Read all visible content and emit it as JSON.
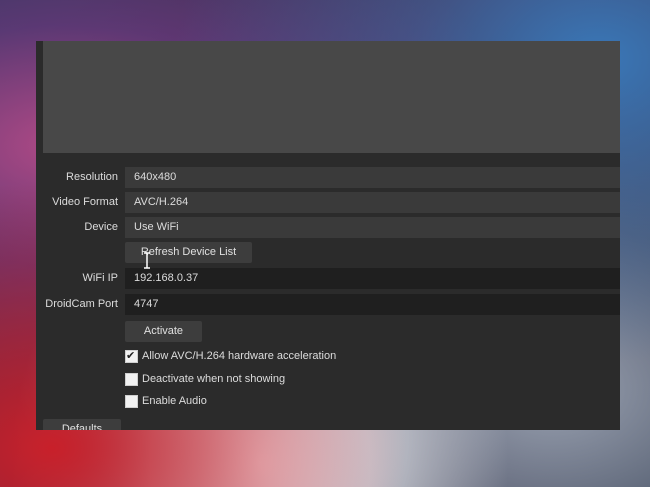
{
  "properties": {
    "resolution": {
      "label": "Resolution",
      "value": "640x480"
    },
    "video_format": {
      "label": "Video Format",
      "value": "AVC/H.264"
    },
    "device": {
      "label": "Device",
      "value": "Use WiFi"
    },
    "refresh_button": "Refresh Device List",
    "wifi_ip": {
      "label": "WiFi IP",
      "value": "192.168.0.37"
    },
    "port": {
      "label": "DroidCam Port",
      "value": "4747"
    },
    "activate_button": "Activate",
    "checkboxes": [
      {
        "label": "Allow AVC/H.264 hardware acceleration",
        "checked": true
      },
      {
        "label": "Deactivate when not showing",
        "checked": false
      },
      {
        "label": "Enable Audio",
        "checked": false
      }
    ],
    "defaults_button": "Defaults"
  },
  "icons": {
    "checkmark": "checkmark-icon",
    "cursor": "text-cursor-icon"
  }
}
